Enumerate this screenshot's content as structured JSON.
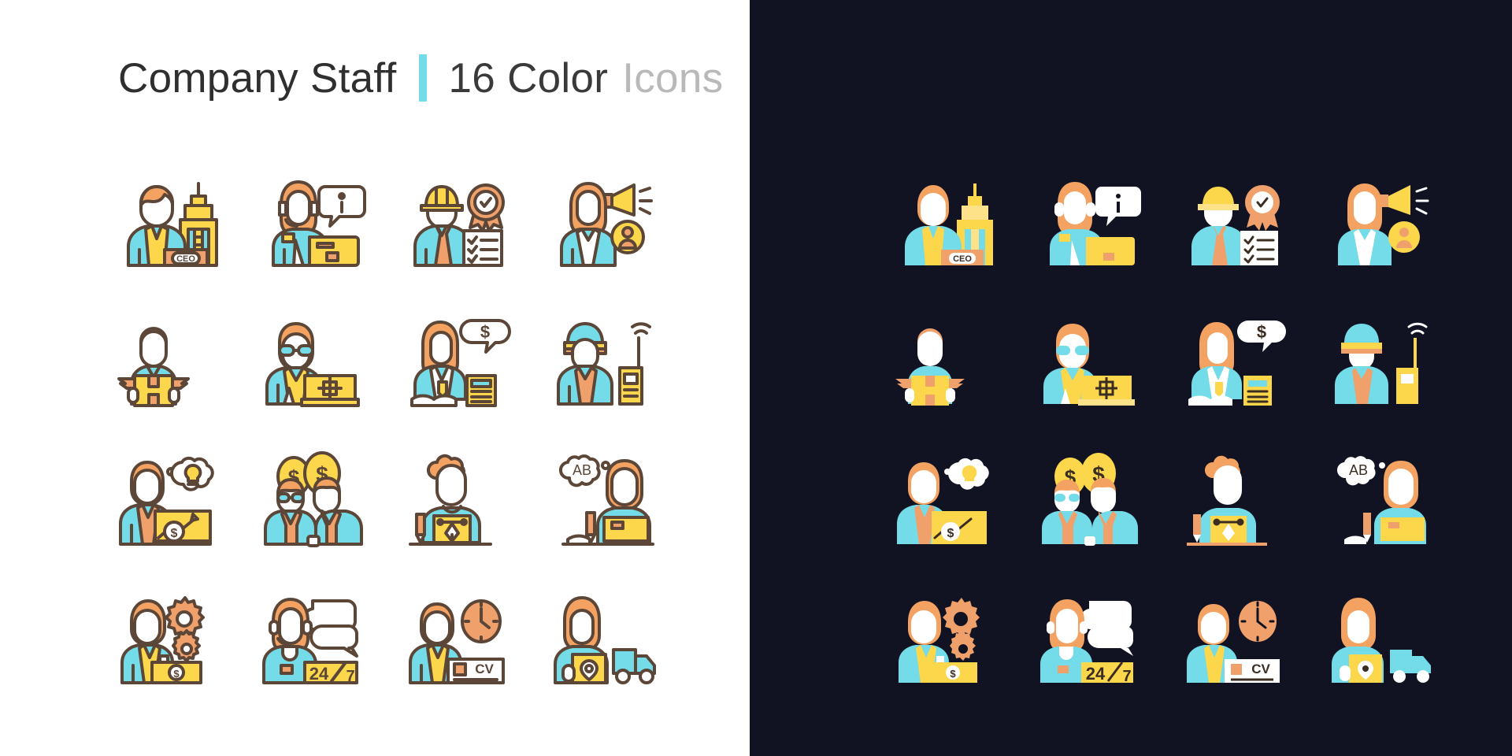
{
  "header": {
    "title": "Company Staff",
    "count": "16 Color",
    "word": "Icons",
    "separator_color": "#74dbe8"
  },
  "palette": {
    "background_light": "#ffffff",
    "background_dark": "#111322",
    "stroke": "#5b4638",
    "skin": "#ffffff",
    "hair_orange": "#f4a261",
    "hair_orange_dark": "#f0a868",
    "cyan": "#74dbe8",
    "yellow": "#fcd64b",
    "yellow_light": "#fde28a",
    "orange": "#f0a06a",
    "orange_strong": "#ef9f5f",
    "white": "#ffffff",
    "title_dark": "#2f2f2f",
    "title_muted": "#b9b9b9"
  },
  "icons": [
    {
      "id": "ceo-executive",
      "row": 1,
      "col": 1,
      "label": "CEO",
      "badge_text": "CEO"
    },
    {
      "id": "call-center-agent",
      "row": 1,
      "col": 2,
      "label": "Information support",
      "badge_text": "i"
    },
    {
      "id": "engineer-certified",
      "row": 1,
      "col": 3,
      "label": "Certified engineer",
      "badge_text": ""
    },
    {
      "id": "marketing-promoter",
      "row": 1,
      "col": 4,
      "label": "Promotion specialist",
      "badge_text": ""
    },
    {
      "id": "courier-delivery",
      "row": 2,
      "col": 1,
      "label": "Courier",
      "badge_text": ""
    },
    {
      "id": "it-specialist",
      "row": 2,
      "col": 2,
      "label": "IT specialist",
      "badge_text": ""
    },
    {
      "id": "accountant",
      "row": 2,
      "col": 3,
      "label": "Accountant",
      "badge_text": "$"
    },
    {
      "id": "security-guard",
      "row": 2,
      "col": 4,
      "label": "Security guard",
      "badge_text": ""
    },
    {
      "id": "business-analyst",
      "row": 3,
      "col": 1,
      "label": "Business analyst",
      "badge_text": "$"
    },
    {
      "id": "investors-pair",
      "row": 3,
      "col": 2,
      "label": "Investors",
      "badge_text": "$"
    },
    {
      "id": "graphic-designer",
      "row": 3,
      "col": 3,
      "label": "Designer",
      "badge_text": ""
    },
    {
      "id": "translator",
      "row": 3,
      "col": 4,
      "label": "Translator",
      "badge_text": "AB"
    },
    {
      "id": "operations-manager",
      "row": 4,
      "col": 1,
      "label": "Manager",
      "badge_text": "$"
    },
    {
      "id": "support-24-7",
      "row": 4,
      "col": 2,
      "label": "24/7 support",
      "badge_text": "24/7"
    },
    {
      "id": "hr-recruiter",
      "row": 4,
      "col": 3,
      "label": "Recruiter",
      "badge_text": "CV"
    },
    {
      "id": "delivery-driver",
      "row": 4,
      "col": 4,
      "label": "Delivery driver",
      "badge_text": ""
    }
  ]
}
